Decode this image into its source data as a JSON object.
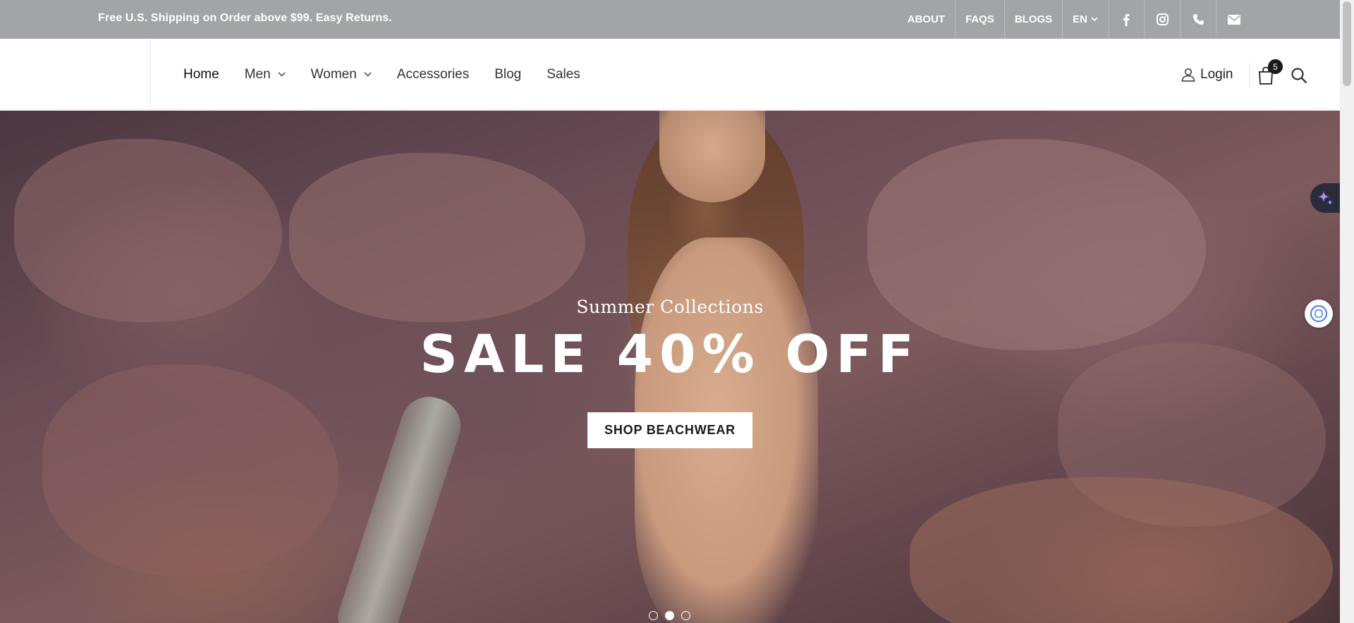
{
  "topbar": {
    "promo": "Free U.S. Shipping on Order above $99. Easy Returns.",
    "links": [
      "ABOUT",
      "FAQS",
      "BLOGS"
    ],
    "language": "EN",
    "social_icons": [
      "facebook-icon",
      "instagram-icon",
      "phone-icon",
      "envelope-icon"
    ],
    "bg_color": "#a3a4a7"
  },
  "nav": {
    "items": [
      {
        "label": "Home",
        "dropdown": false
      },
      {
        "label": "Men",
        "dropdown": true
      },
      {
        "label": "Women",
        "dropdown": true
      },
      {
        "label": "Accessories",
        "dropdown": false
      },
      {
        "label": "Blog",
        "dropdown": false
      },
      {
        "label": "Sales",
        "dropdown": false
      }
    ],
    "login_label": "Login",
    "cart_count": "5"
  },
  "hero": {
    "subtitle": "Summer Collections",
    "title": "SALE 40% OFF",
    "button_label": "SHOP BEACHWEAR",
    "slides": 3,
    "active_slide": 2
  },
  "icons": {
    "user": "user-icon",
    "cart": "shopping-bag-icon",
    "search": "search-icon",
    "ai": "sparkle-icon",
    "chat": "chat-assistant-icon"
  }
}
